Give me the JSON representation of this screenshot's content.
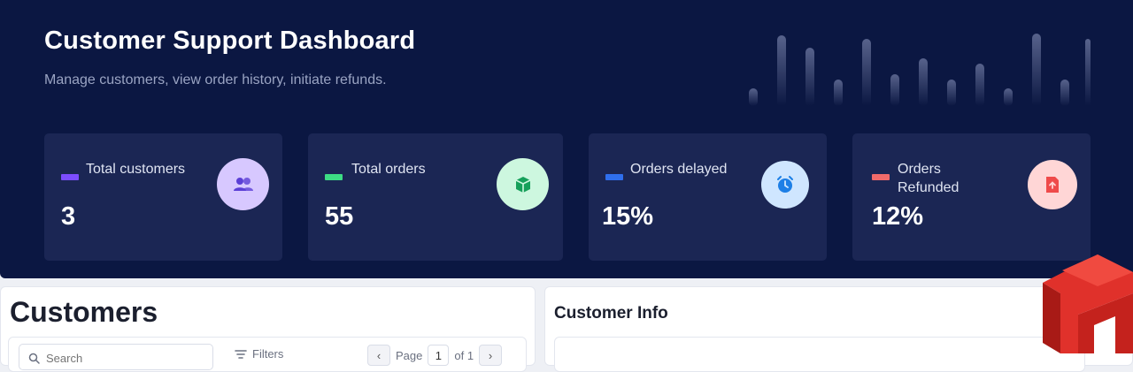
{
  "header": {
    "title": "Customer Support Dashboard",
    "subtitle": "Manage customers, view order history, initiate refunds."
  },
  "stats": [
    {
      "label": "Total customers",
      "value": "3",
      "swatch_color": "#7c4dff",
      "icon": "users-icon",
      "badge_bg": "#d7c8ff",
      "icon_color": "#5b3fd6"
    },
    {
      "label": "Total orders",
      "value": "55",
      "swatch_color": "#3ddc84",
      "icon": "package-icon",
      "badge_bg": "#cdf7df",
      "icon_color": "#16a05a"
    },
    {
      "label": "Orders delayed",
      "value": "15%",
      "swatch_color": "#2f6fed",
      "icon": "alarm-clock-icon",
      "badge_bg": "#cfe6ff",
      "icon_color": "#1d7fe6"
    },
    {
      "label": "Orders Refunded",
      "value": "12%",
      "swatch_color": "#f06a6a",
      "icon": "refund-document-icon",
      "badge_bg": "#ffd6d6",
      "icon_color": "#ef4a4a"
    }
  ],
  "customers_panel": {
    "title": "Customers",
    "search_placeholder": "Search",
    "filter_label": "Filters",
    "page_label": "Page",
    "page_current": "1",
    "page_total_label": "of 1"
  },
  "info_panel": {
    "title": "Customer Info"
  },
  "colors": {
    "hero_bg": "#0b1742",
    "card_bg": "#1b2654",
    "logo_red": "#e0312b"
  }
}
